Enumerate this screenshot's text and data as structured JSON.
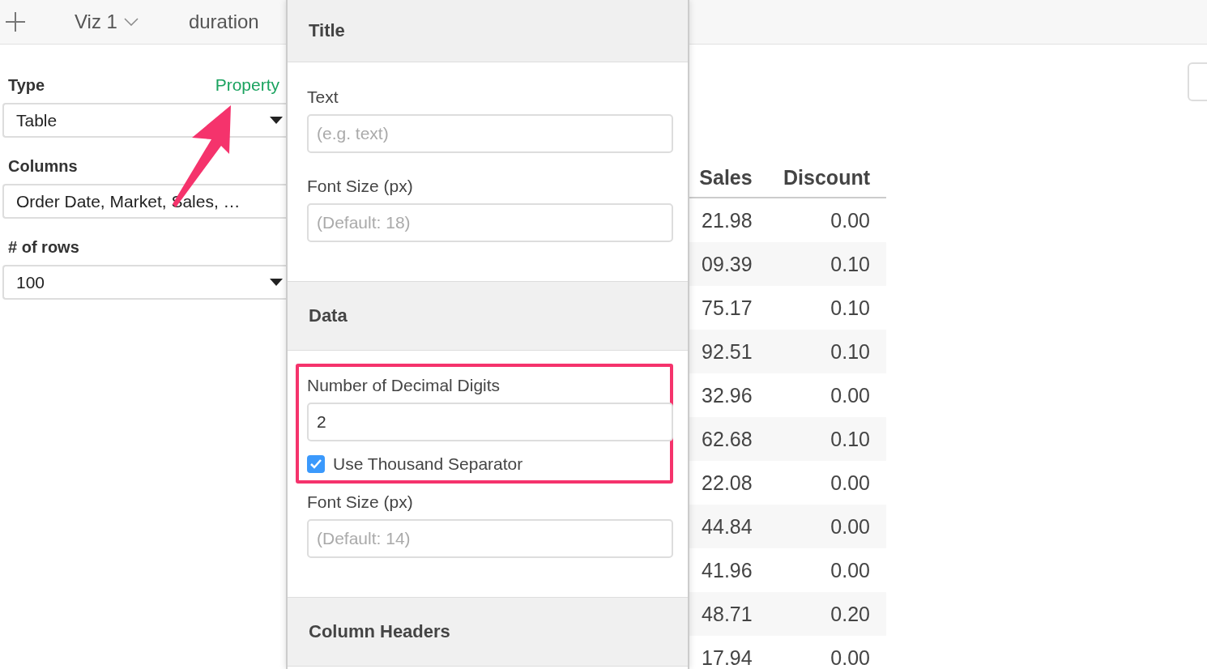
{
  "top_bar": {
    "tabs": [
      {
        "label": "Viz 1",
        "dropdown": true
      },
      {
        "label": "duration",
        "dropdown": false
      }
    ]
  },
  "left_panel": {
    "property_link": "Property",
    "fields": [
      {
        "kind": "select",
        "label": "Type",
        "value": "Table"
      },
      {
        "kind": "text",
        "label": "Columns",
        "value": "Order Date, Market, Sales, …"
      },
      {
        "kind": "select",
        "label": "# of rows",
        "value": "100"
      }
    ]
  },
  "popover": {
    "sections": [
      {
        "title": "Title",
        "fields": [
          {
            "kind": "text",
            "label": "Text",
            "placeholder": "(e.g. text)"
          },
          {
            "kind": "text",
            "label": "Font Size (px)",
            "placeholder": "(Default: 18)"
          }
        ]
      },
      {
        "title": "Data",
        "fields": [
          {
            "kind": "highlight",
            "fields": [
              {
                "kind": "text",
                "label": "Number of Decimal Digits",
                "value": "2"
              },
              {
                "kind": "checkbox",
                "label": "Use Thousand Separator",
                "checked": true
              }
            ]
          },
          {
            "kind": "text",
            "label": "Font Size (px)",
            "placeholder": "(Default: 14)"
          }
        ]
      },
      {
        "title": "Column Headers"
      }
    ]
  },
  "main": {
    "table": {
      "columns": [
        "Sales",
        "Discount"
      ],
      "rows": [
        [
          "21.98",
          "0.00"
        ],
        [
          "09.39",
          "0.10"
        ],
        [
          "75.17",
          "0.10"
        ],
        [
          "92.51",
          "0.10"
        ],
        [
          "32.96",
          "0.00"
        ],
        [
          "62.68",
          "0.10"
        ],
        [
          "22.08",
          "0.00"
        ],
        [
          "44.84",
          "0.00"
        ],
        [
          "41.96",
          "0.00"
        ],
        [
          "48.71",
          "0.20"
        ],
        [
          "17.94",
          "0.00"
        ]
      ]
    }
  }
}
